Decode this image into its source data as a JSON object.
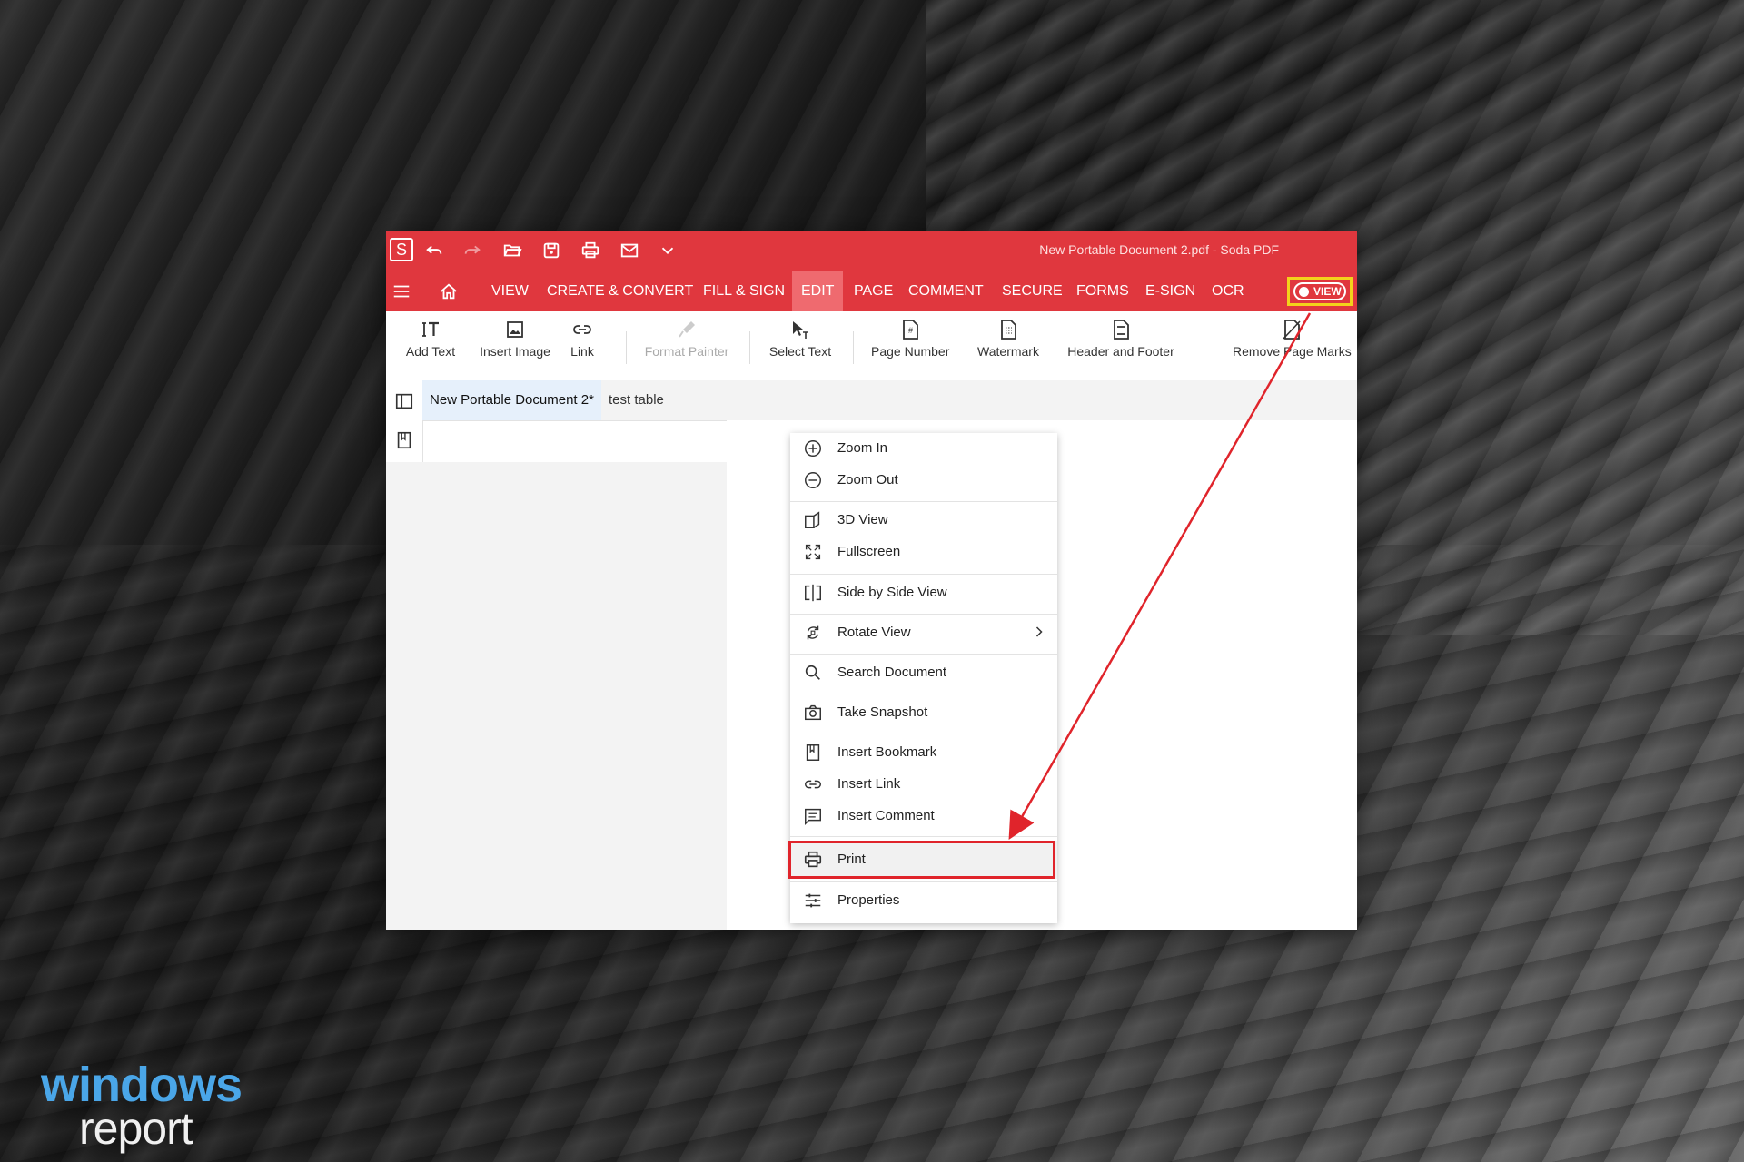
{
  "window": {
    "title": "New Portable Document 2.pdf  -  Soda PDF",
    "logo_letter": "S"
  },
  "quick_access": {
    "icons": [
      "undo-icon",
      "redo-icon",
      "open-icon",
      "save-icon",
      "print-icon",
      "email-icon",
      "dropdown-icon"
    ]
  },
  "menu": {
    "tabs": [
      {
        "label": "VIEW"
      },
      {
        "label": "CREATE & CONVERT"
      },
      {
        "label": "FILL & SIGN"
      },
      {
        "label": "EDIT"
      },
      {
        "label": "PAGE"
      },
      {
        "label": "COMMENT"
      },
      {
        "label": "SECURE"
      },
      {
        "label": "FORMS"
      },
      {
        "label": "E-SIGN"
      },
      {
        "label": "OCR"
      }
    ],
    "active_tab": "EDIT",
    "view_toggle_label": "VIEW"
  },
  "ribbon": {
    "tools": [
      {
        "label": "Add Text",
        "icon": "add-text-icon"
      },
      {
        "label": "Insert Image",
        "icon": "insert-image-icon"
      },
      {
        "label": "Link",
        "icon": "link-icon"
      },
      {
        "label": "Format Painter",
        "icon": "format-painter-icon",
        "disabled": true
      },
      {
        "label": "Select Text",
        "icon": "select-text-icon"
      },
      {
        "label": "Page Number",
        "icon": "page-number-icon"
      },
      {
        "label": "Watermark",
        "icon": "watermark-icon"
      },
      {
        "label": "Header and Footer",
        "icon": "header-footer-icon"
      },
      {
        "label": "Remove Page Marks",
        "icon": "remove-page-marks-icon"
      }
    ]
  },
  "doc_tabs": [
    {
      "label": "New Portable Document 2*",
      "active": true
    },
    {
      "label": "test table",
      "active": false
    }
  ],
  "context_menu": {
    "items": [
      {
        "label": "Zoom In",
        "icon": "zoom-in-icon"
      },
      {
        "label": "Zoom Out",
        "icon": "zoom-out-icon"
      },
      {
        "label": "3D View",
        "icon": "3d-view-icon"
      },
      {
        "label": "Fullscreen",
        "icon": "fullscreen-icon"
      },
      {
        "label": "Side by Side View",
        "icon": "side-by-side-icon"
      },
      {
        "label": "Rotate View",
        "icon": "rotate-icon",
        "submenu": true
      },
      {
        "label": "Search Document",
        "icon": "search-icon"
      },
      {
        "label": "Take Snapshot",
        "icon": "camera-icon"
      },
      {
        "label": "Insert Bookmark",
        "icon": "bookmark-icon"
      },
      {
        "label": "Insert Link",
        "icon": "link-icon"
      },
      {
        "label": "Insert Comment",
        "icon": "comment-icon"
      },
      {
        "label": "Print",
        "icon": "print-icon",
        "highlighted": true
      },
      {
        "label": "Properties",
        "icon": "properties-icon"
      }
    ]
  },
  "colors": {
    "brand": "#e0373e",
    "active_tab": "#ef6a6f",
    "highlight_yellow": "#f3d21b",
    "annotation_red": "#e0242b"
  },
  "watermark": {
    "line1": "windows",
    "line2": "report"
  }
}
